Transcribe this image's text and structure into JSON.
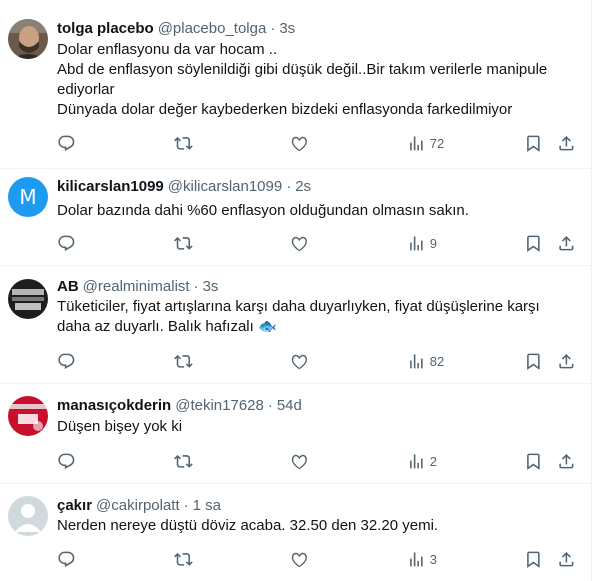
{
  "tweets": [
    {
      "name": "tolga placebo",
      "handle": "@placebo_tolga",
      "time": "3s",
      "lines": [
        "Dolar enflasyonu da var hocam ..",
        "Abd de enflasyon söylenildiği gibi düşük değil..Bir takım verilerle manipule ediyorlar",
        "Dünyada dolar değer kaybederken bizdeki enflasyonda farkedilmiyor"
      ],
      "views": "72",
      "avatar": "photo"
    },
    {
      "name": "kilicarslan1099",
      "handle": "@kilicarslan1099",
      "time": "2s",
      "lines": [
        "Dolar bazında dahi %60 enflasyon olduğundan olmasın sakın."
      ],
      "views": "9",
      "avatar": "M"
    },
    {
      "name": "AB",
      "handle": "@realminimalist",
      "time": "3s",
      "lines": [
        "Tüketiciler, fiyat artışlarına karşı daha duyarlıyken, fiyat düşüşlerine karşı daha az duyarlı. Balık hafızalı 🐟"
      ],
      "views": "82",
      "avatar": "only fools and horses"
    },
    {
      "name": "manasıçokderin",
      "handle": "@tekin17628",
      "time": "54d",
      "lines": [
        "Düşen bişey yok ki"
      ],
      "views": "2",
      "avatar": "100 yıl"
    },
    {
      "name": "çakır",
      "handle": "@cakirpolatt",
      "time": "1 sa",
      "lines": [
        "Nerden nereye düştü döviz acaba. 32.50 den 32.20 yemi."
      ],
      "views": "3",
      "avatar": "default"
    }
  ],
  "colors": {
    "text": "#0f1419",
    "muted": "#536471",
    "border": "#eff3f4",
    "avatar_blue": "#1d9bf0"
  },
  "icons": [
    "reply-icon",
    "retweet-icon",
    "like-icon",
    "views-icon",
    "bookmark-icon",
    "share-icon"
  ]
}
